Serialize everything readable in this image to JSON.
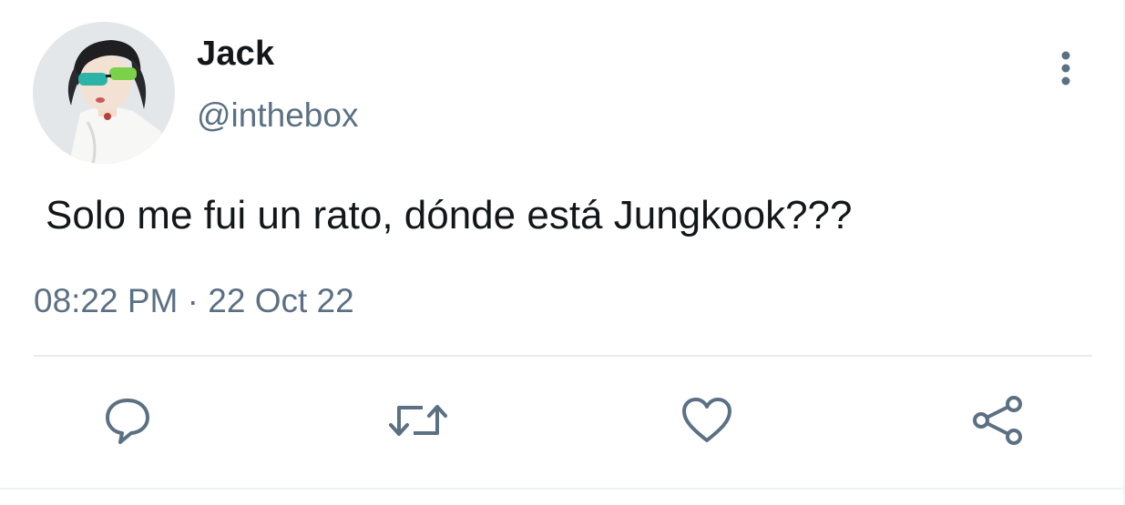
{
  "user": {
    "display_name": "Jack",
    "handle": "@inthebox",
    "avatar": "profile-photo"
  },
  "tweet": {
    "text": "Solo me fui un rato, dónde está Jungkook???",
    "time": "08:22 PM",
    "separator": "·",
    "date": "22 Oct 22"
  },
  "actions": {
    "more": "more-vertical-icon",
    "reply": "reply-icon",
    "retweet": "retweet-icon",
    "like": "heart-icon",
    "share": "share-icon"
  },
  "colors": {
    "text_primary": "#14171a",
    "text_secondary": "#5b7083",
    "divider": "#e6ecf0"
  }
}
